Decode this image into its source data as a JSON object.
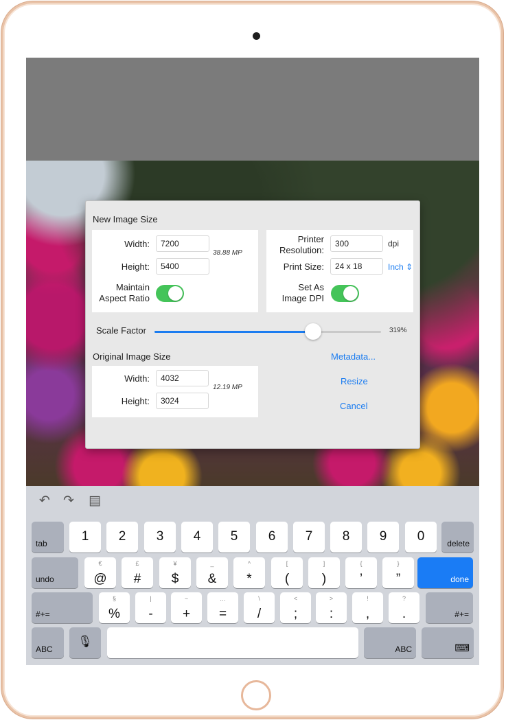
{
  "dialog": {
    "new_size_title": "New Image Size",
    "width_label": "Width:",
    "width_value": "7200",
    "height_label": "Height:",
    "height_value": "5400",
    "new_mp": "38.88 MP",
    "maintain_label_1": "Maintain",
    "maintain_label_2": "Aspect Ratio",
    "maintain_on": true,
    "printer_label_1": "Printer",
    "printer_label_2": "Resolution:",
    "printer_value": "300",
    "printer_unit": "dpi",
    "print_size_label": "Print Size:",
    "print_size_value": "24 x 18",
    "print_size_unit": "Inch",
    "set_dpi_label_1": "Set As",
    "set_dpi_label_2": "Image DPI",
    "set_dpi_on": true,
    "scale_label": "Scale Factor",
    "scale_value": "319%",
    "scale_fraction": 0.7,
    "original_title": "Original Image Size",
    "orig_width_label": "Width:",
    "orig_width_value": "4032",
    "orig_height_label": "Height:",
    "orig_height_value": "3024",
    "orig_mp": "12.19 MP",
    "metadata_link": "Metadata...",
    "resize_link": "Resize",
    "cancel_link": "Cancel"
  },
  "keyboard": {
    "toolbar": [
      "undo-icon",
      "redo-icon",
      "paste-icon"
    ],
    "row1": {
      "tab": "tab",
      "keys": [
        "1",
        "2",
        "3",
        "4",
        "5",
        "6",
        "7",
        "8",
        "9",
        "0"
      ],
      "delete": "delete"
    },
    "row2": {
      "undo": "undo",
      "keys": [
        {
          "main": "@",
          "alt": "€"
        },
        {
          "main": "#",
          "alt": "£"
        },
        {
          "main": "$",
          "alt": "¥"
        },
        {
          "main": "&",
          "alt": "_"
        },
        {
          "main": "*",
          "alt": "^"
        },
        {
          "main": "(",
          "alt": "["
        },
        {
          "main": ")",
          "alt": "]"
        },
        {
          "main": "’",
          "alt": "{"
        },
        {
          "main": "”",
          "alt": "}"
        }
      ],
      "done": "done"
    },
    "row3": {
      "left": "#+=",
      "keys": [
        {
          "main": "%",
          "alt": "§"
        },
        {
          "main": "-",
          "alt": "|"
        },
        {
          "main": "+",
          "alt": "~"
        },
        {
          "main": "=",
          "alt": "…"
        },
        {
          "main": "/",
          "alt": "\\"
        },
        {
          "main": ";",
          "alt": "<"
        },
        {
          "main": ":",
          "alt": ">"
        },
        {
          "main": ",",
          "alt": "!"
        },
        {
          "main": ".",
          "alt": "?"
        }
      ],
      "right": "#+="
    },
    "row4": {
      "abc_left": "ABC",
      "mic": "microphone-icon",
      "space": "",
      "abc_right": "ABC",
      "hide": "keyboard-dismiss-icon"
    }
  },
  "colors": {
    "accent": "#1b7cf0",
    "toggle_on": "#44c459",
    "done_key": "#1a7cf5",
    "device_frame": "#e9c3a8"
  }
}
